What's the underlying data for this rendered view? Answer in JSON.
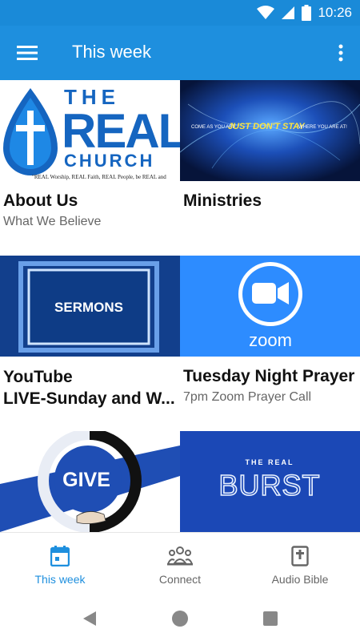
{
  "status_bar": {
    "time": "10:26"
  },
  "app_bar": {
    "title": "This week"
  },
  "cards": [
    {
      "title": "About Us",
      "subtitle": "What We Believe",
      "image": {
        "line1": "THE",
        "line2": "REAL",
        "line3": "CHURCH",
        "caption": "\"REAL Worship, REAL Faith, REAL People, be REAL and"
      }
    },
    {
      "title": "Ministries",
      "subtitle": "",
      "image": {
        "left": "COME AS YOU ARE",
        "middle": "JUST DON'T STAY",
        "right": "WHERE YOU ARE AT!"
      }
    },
    {
      "title_line1": "YouTube",
      "title_line2": "LIVE-Sunday and W...",
      "subtitle": "",
      "image": {
        "text": "SERMONS"
      }
    },
    {
      "title": "Tuesday Night Prayer",
      "subtitle": "7pm Zoom Prayer Call",
      "image": {
        "text": "zoom"
      }
    },
    {
      "image": {
        "text": "GIVE"
      }
    },
    {
      "image": {
        "line1": "THE REAL",
        "line2": "BURST"
      }
    }
  ],
  "bottom_nav": [
    {
      "label": "This week",
      "icon": "calendar-icon",
      "active": true
    },
    {
      "label": "Connect",
      "icon": "group-icon",
      "active": false
    },
    {
      "label": "Audio Bible",
      "icon": "bible-icon",
      "active": false
    }
  ],
  "colors": {
    "primary": "#1e8fde",
    "status_bar": "#1a8ad8",
    "zoom_blue": "#2d8cff",
    "give_blue": "#1f4eb4"
  }
}
